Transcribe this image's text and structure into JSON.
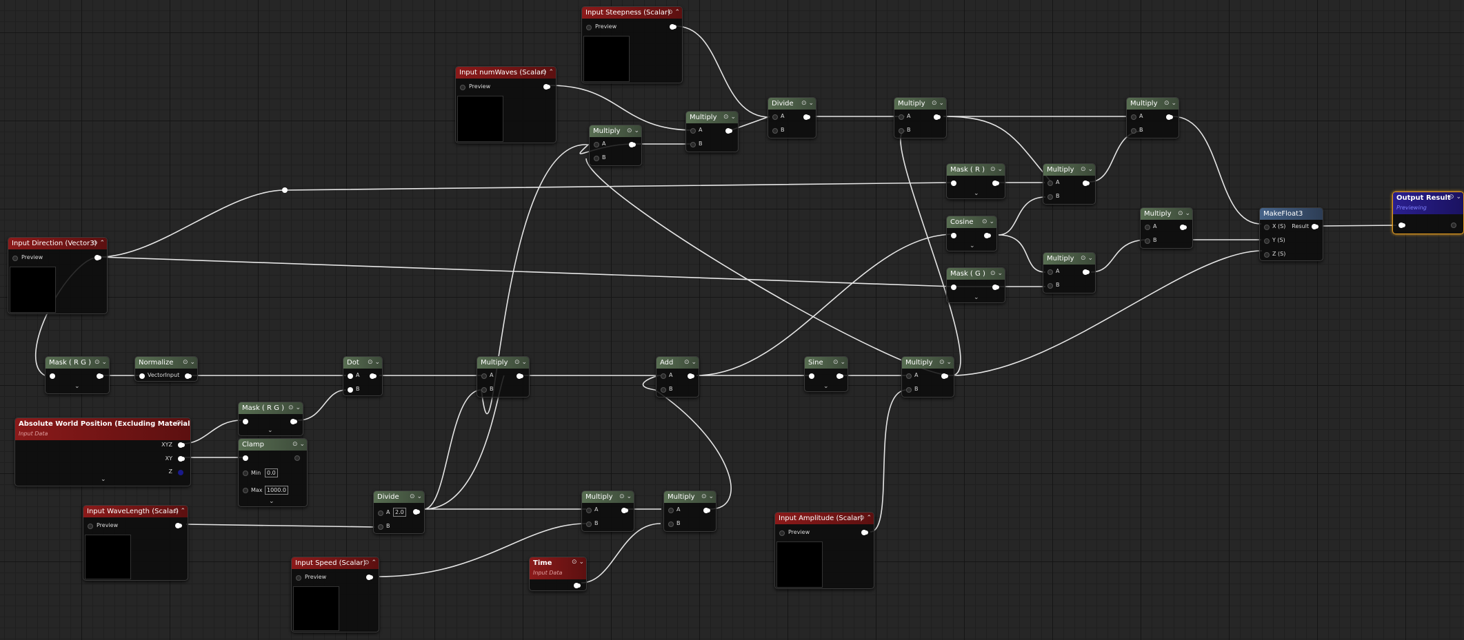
{
  "labels": {
    "preview": "Preview",
    "input_data": "Input Data",
    "a": "A",
    "b": "B",
    "result": "Result",
    "previewing": "Previewing",
    "vector_input": "VectorInput",
    "min": "Min",
    "max": "Max",
    "xyz": "XYZ",
    "xy": "XY",
    "z": "Z",
    "x_s": "X (S)",
    "y_s": "Y (S)",
    "z_s": "Z (S)",
    "header_icons": "⊙ ⌃",
    "header_icons_down": "⊙ ⌄",
    "expand": "⌄"
  },
  "nodes": {
    "steepness": "Input Steepness (Scalar)",
    "numwaves": "Input numWaves (Scalar)",
    "direction": "Input Direction (Vector3)",
    "world_pos": "Absolute World Position (Excluding Material Offsets)",
    "wavelength": "Input WaveLength (Scalar)",
    "speed": "Input Speed (Scalar)",
    "time": "Time",
    "amplitude": "Input Amplitude (Scalar)",
    "output": "Output Result",
    "makefloat3": "MakeFloat3",
    "mask_rg": "Mask ( R G )",
    "mask_r": "Mask ( R )",
    "mask_g": "Mask ( G )",
    "normalize": "Normalize",
    "dot": "Dot",
    "clamp": "Clamp",
    "divide": "Divide",
    "multiply": "Multiply",
    "add": "Add",
    "sine": "Sine",
    "cosine": "Cosine"
  },
  "values": {
    "divide_a": "2.0",
    "clamp_min": "0.0",
    "clamp_max": "1000.0"
  },
  "colors": {
    "canvas": "#262626",
    "input_header": "#8b1a1a",
    "math_header": "#586e52",
    "make_header": "#46648a",
    "output_header": "#2a1f8e",
    "selection": "#e8a020",
    "wire": "#e6e6e6"
  }
}
